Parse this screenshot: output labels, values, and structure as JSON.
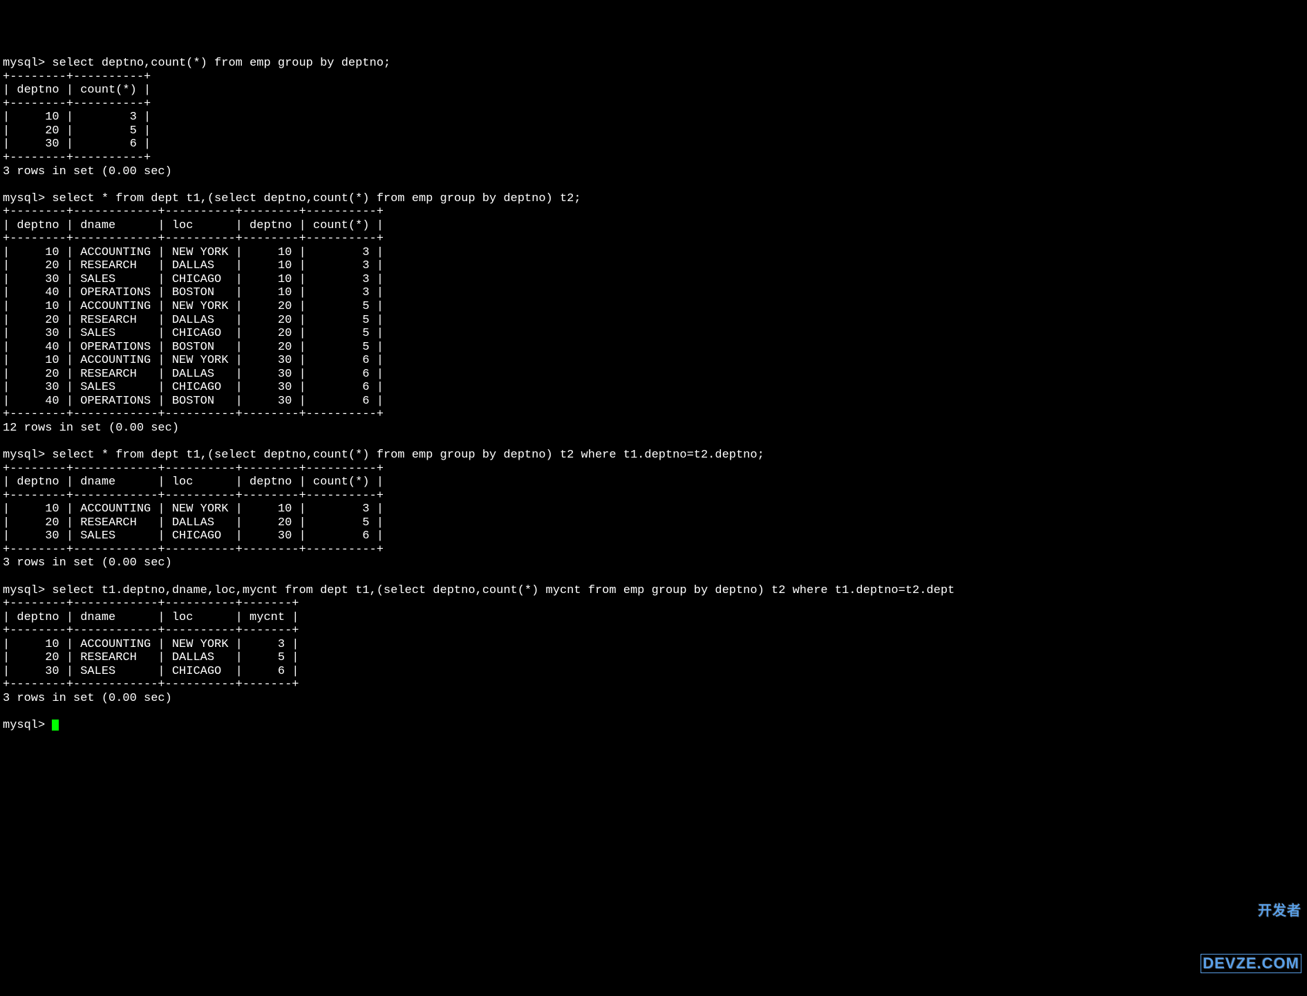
{
  "prompt": "mysql>",
  "queries": {
    "q1": "select deptno,count(*) from emp group by deptno;",
    "q2": "select * from dept t1,(select deptno,count(*) from emp group by deptno) t2;",
    "q3": "select * from dept t1,(select deptno,count(*) from emp group by deptno) t2 where t1.deptno=t2.deptno;",
    "q4": "select t1.deptno,dname,loc,mycnt from dept t1,(select deptno,count(*) mycnt from emp group by deptno) t2 where t1.deptno=t2.dept"
  },
  "tables": {
    "t1": {
      "border": "+--------+----------+",
      "header": "| deptno | count(*) |",
      "rows": [
        "|     10 |        3 |",
        "|     20 |        5 |",
        "|     30 |        6 |"
      ],
      "footer": "3 rows in set (0.00 sec)"
    },
    "t2": {
      "border": "+--------+------------+----------+--------+----------+",
      "header": "| deptno | dname      | loc      | deptno | count(*) |",
      "rows": [
        "|     10 | ACCOUNTING | NEW YORK |     10 |        3 |",
        "|     20 | RESEARCH   | DALLAS   |     10 |        3 |",
        "|     30 | SALES      | CHICAGO  |     10 |        3 |",
        "|     40 | OPERATIONS | BOSTON   |     10 |        3 |",
        "|     10 | ACCOUNTING | NEW YORK |     20 |        5 |",
        "|     20 | RESEARCH   | DALLAS   |     20 |        5 |",
        "|     30 | SALES      | CHICAGO  |     20 |        5 |",
        "|     40 | OPERATIONS | BOSTON   |     20 |        5 |",
        "|     10 | ACCOUNTING | NEW YORK |     30 |        6 |",
        "|     20 | RESEARCH   | DALLAS   |     30 |        6 |",
        "|     30 | SALES      | CHICAGO  |     30 |        6 |",
        "|     40 | OPERATIONS | BOSTON   |     30 |        6 |"
      ],
      "footer": "12 rows in set (0.00 sec)"
    },
    "t3": {
      "border": "+--------+------------+----------+--------+----------+",
      "header": "| deptno | dname      | loc      | deptno | count(*) |",
      "rows": [
        "|     10 | ACCOUNTING | NEW YORK |     10 |        3 |",
        "|     20 | RESEARCH   | DALLAS   |     20 |        5 |",
        "|     30 | SALES      | CHICAGO  |     30 |        6 |"
      ],
      "footer": "3 rows in set (0.00 sec)"
    },
    "t4": {
      "border": "+--------+------------+----------+-------+",
      "header": "| deptno | dname      | loc      | mycnt |",
      "rows": [
        "|     10 | ACCOUNTING | NEW YORK |     3 |",
        "|     20 | RESEARCH   | DALLAS   |     5 |",
        "|     30 | SALES      | CHICAGO  |     6 |"
      ],
      "footer": "3 rows in set (0.00 sec)"
    }
  },
  "final_prompt": "mysql> ",
  "watermark": {
    "top": "开发者",
    "bottom": "DEVZE.COM"
  }
}
